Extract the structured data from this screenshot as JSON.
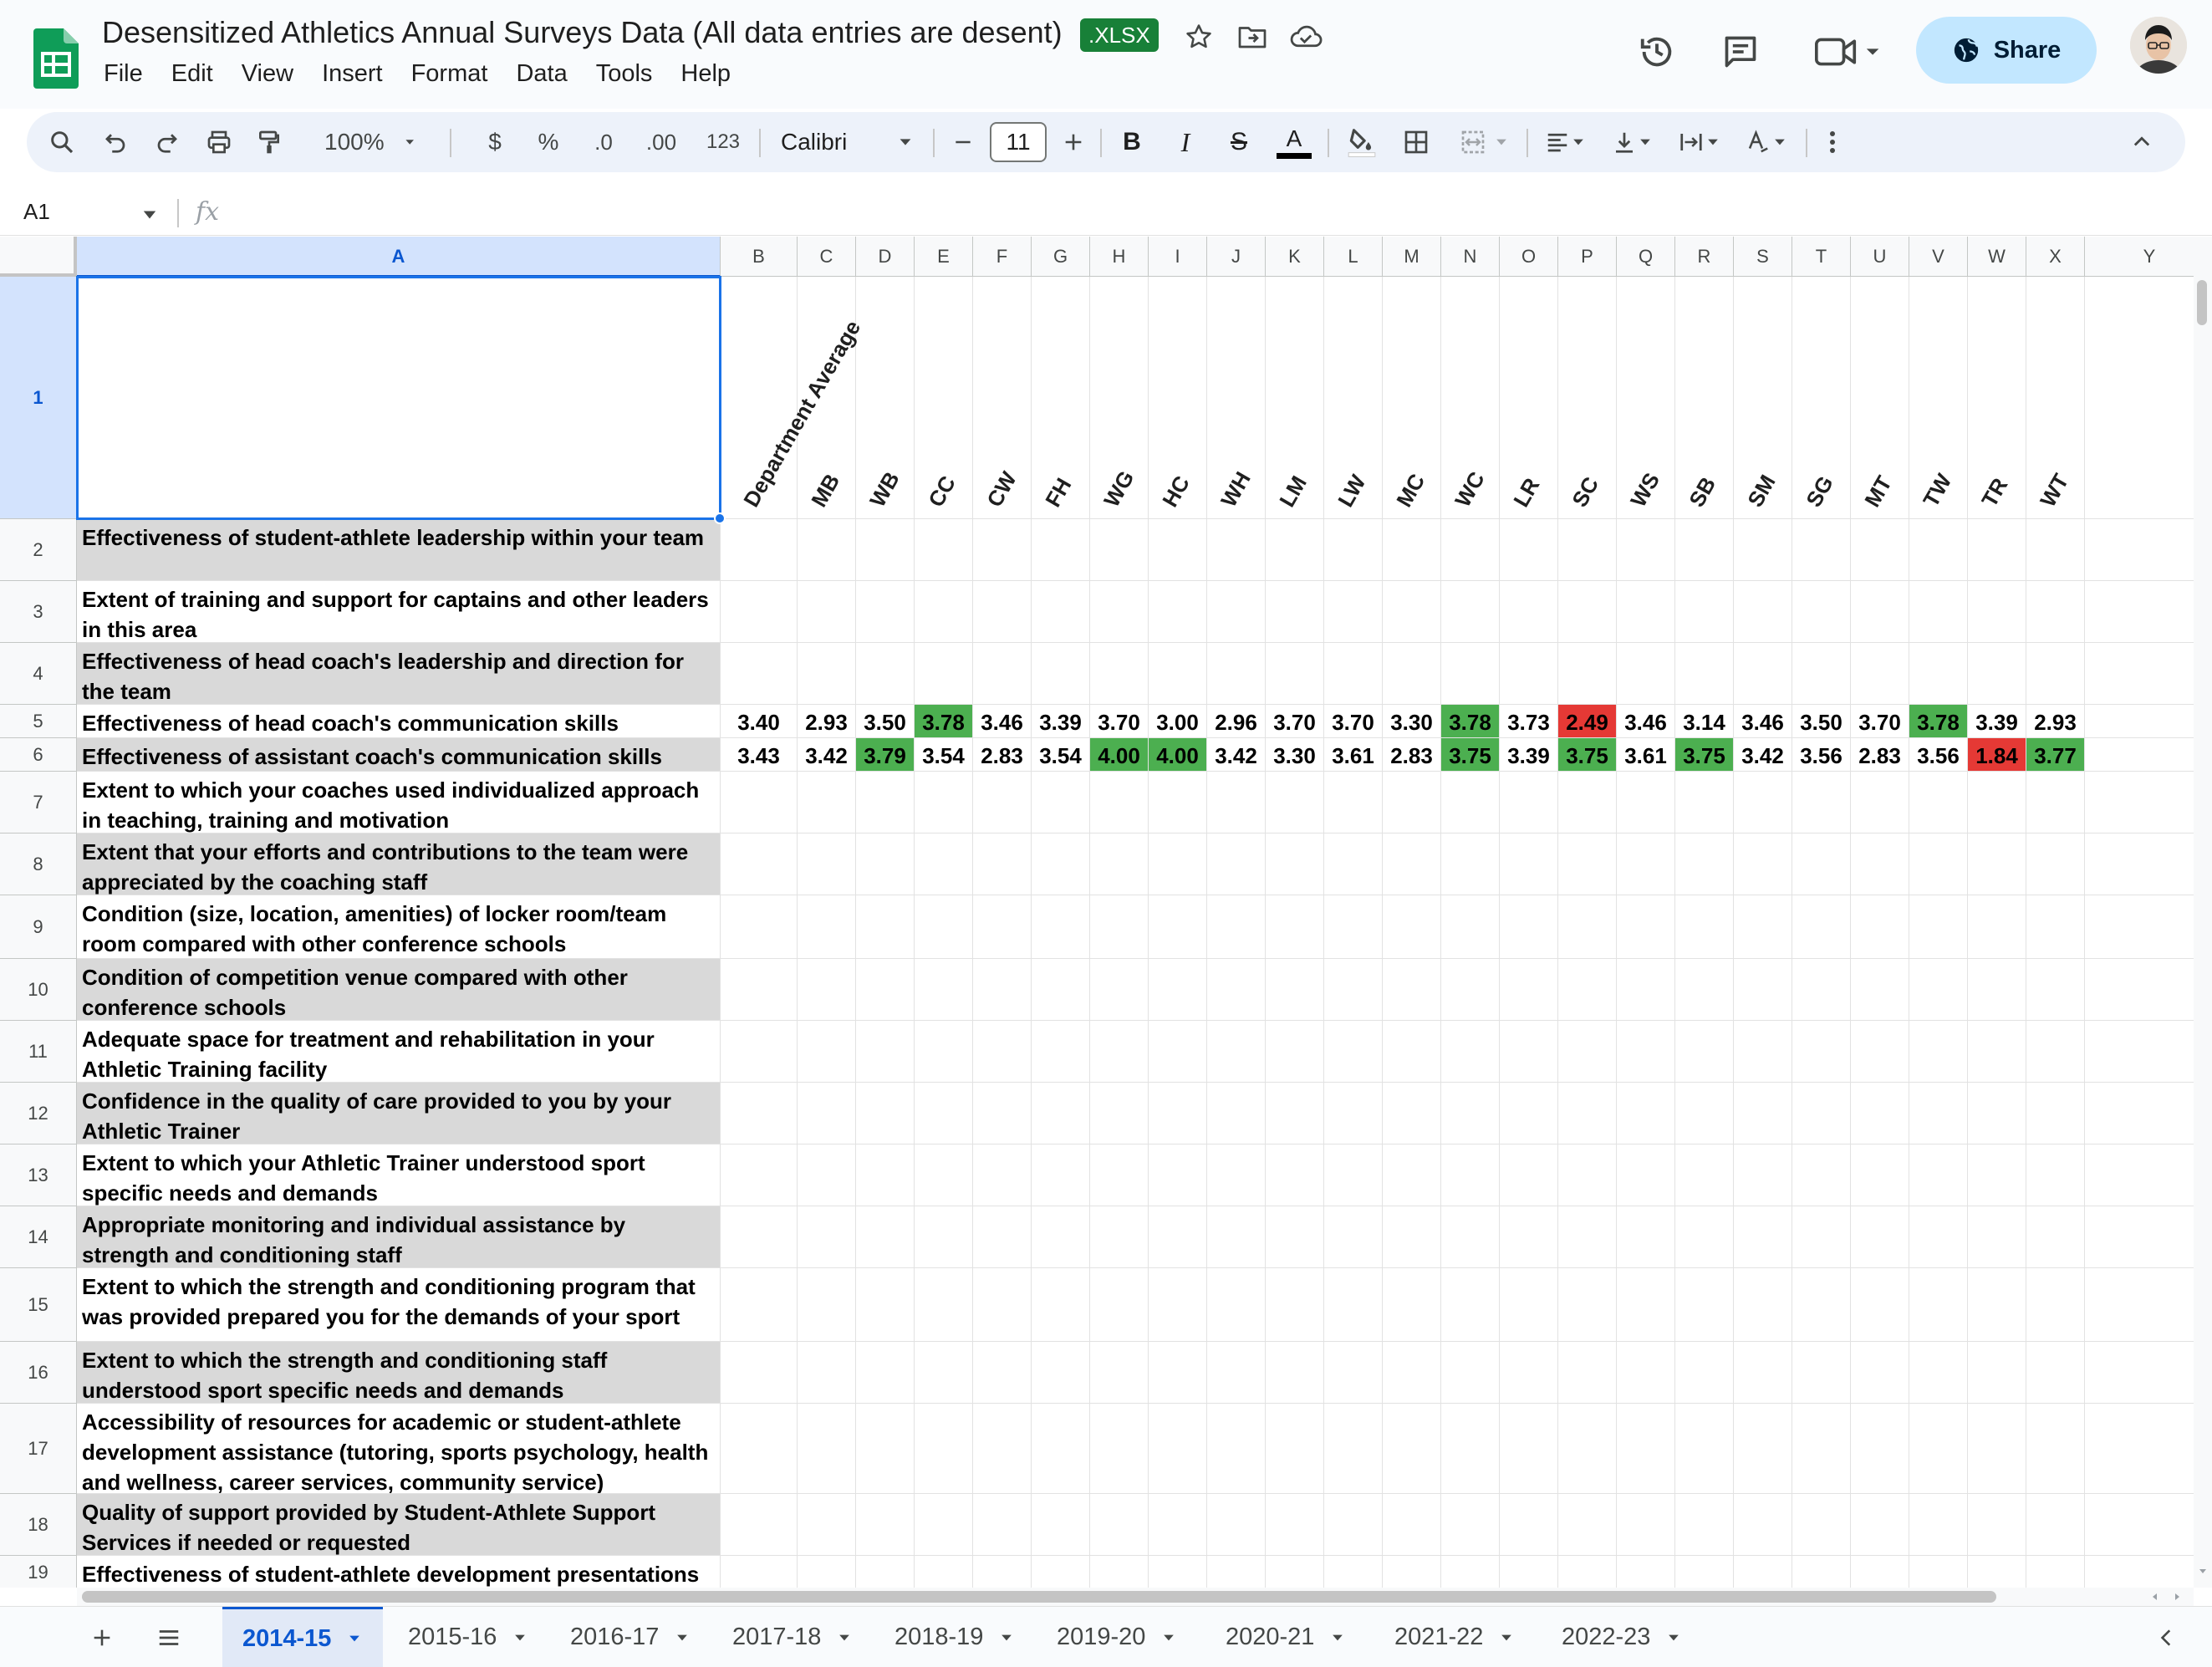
{
  "document": {
    "title": "Desensitized Athletics Annual Surveys Data (All data entries are desent)",
    "format_badge": ".XLSX"
  },
  "menu": [
    "File",
    "Edit",
    "View",
    "Insert",
    "Format",
    "Data",
    "Tools",
    "Help"
  ],
  "share": {
    "label": "Share"
  },
  "toolbar": {
    "zoom": "100%",
    "currency": "$",
    "percent": "%",
    "decrease_decimal": ".0",
    "increase_decimal": ".00",
    "number_format": "123",
    "font": "Calibri",
    "font_size": "11",
    "bold": "B",
    "italic": "I",
    "strike": "S",
    "text_color": "A"
  },
  "formula_bar": {
    "cell_ref": "A1",
    "fx": "fx",
    "value": ""
  },
  "grid": {
    "column_headers": [
      "A",
      "B",
      "C",
      "D",
      "E",
      "F",
      "G",
      "H",
      "I",
      "J",
      "K",
      "L",
      "M",
      "N",
      "O",
      "P",
      "Q",
      "R",
      "S",
      "T",
      "U",
      "V",
      "W",
      "X",
      "Y"
    ],
    "row_numbers": [
      "1",
      "2",
      "3",
      "4",
      "5",
      "6",
      "7",
      "8",
      "9",
      "10",
      "11",
      "12",
      "13",
      "14",
      "15",
      "16",
      "17",
      "18",
      "19"
    ],
    "team_headers": [
      "Department Average",
      "MB",
      "WB",
      "CC",
      "CW",
      "FH",
      "WG",
      "HC",
      "WH",
      "LM",
      "LW",
      "MC",
      "WC",
      "LR",
      "SC",
      "WS",
      "SB",
      "SM",
      "SG",
      "MT",
      "TW",
      "TR",
      "WT"
    ],
    "questions": [
      "",
      "Effectiveness of student-athlete leadership within your team",
      "Extent of training and support for captains and other leaders in this area",
      "Effectiveness of head coach's leadership and direction for the team",
      "Effectiveness of head coach's communication skills",
      "Effectiveness of assistant coach's communication skills",
      "Extent to which your coaches used individualized approach in teaching, training and motivation",
      "Extent that your efforts and contributions to the team were appreciated by the coaching staff",
      "Condition (size, location, amenities) of locker room/team room compared with other conference schools",
      "Condition of competition venue compared with other conference schools",
      "Adequate space for treatment and rehabilitation in your Athletic Training facility",
      "Confidence in the quality of care provided to you by your Athletic Trainer",
      "Extent to which your Athletic Trainer understood sport specific needs and demands",
      "Appropriate monitoring and individual assistance by strength and conditioning staff",
      "Extent to which the strength and conditioning program that was provided prepared you for the demands of your sport",
      "Extent to which the strength and conditioning staff understood sport specific needs and demands",
      "Accessibility of resources for academic or student-athlete development assistance (tutoring, sports psychology, health and wellness, career services, community service)",
      "Quality of support provided by Student-Athlete Support Services if needed or requested",
      "Effectiveness of student-athlete development presentations"
    ],
    "row5_values": [
      "3.40",
      "2.93",
      "3.50",
      "3.78",
      "3.46",
      "3.39",
      "3.70",
      "3.00",
      "2.96",
      "3.70",
      "3.70",
      "3.30",
      "3.78",
      "3.73",
      "2.49",
      "3.46",
      "3.14",
      "3.46",
      "3.50",
      "3.70",
      "3.78",
      "3.39",
      "2.93"
    ],
    "row5_colors": [
      "",
      "",
      "",
      "green",
      "",
      "",
      "",
      "",
      "",
      "",
      "",
      "",
      "green",
      "",
      "red",
      "",
      "",
      "",
      "",
      "",
      "green",
      "",
      ""
    ],
    "row6_values": [
      "3.43",
      "3.42",
      "3.79",
      "3.54",
      "2.83",
      "3.54",
      "4.00",
      "4.00",
      "3.42",
      "3.30",
      "3.61",
      "2.83",
      "3.75",
      "3.39",
      "3.75",
      "3.61",
      "3.75",
      "3.42",
      "3.56",
      "2.83",
      "3.56",
      "1.84",
      "3.77"
    ],
    "row6_colors": [
      "",
      "",
      "green",
      "",
      "",
      "",
      "green",
      "green",
      "",
      "",
      "",
      "",
      "green",
      "",
      "green",
      "",
      "green",
      "",
      "",
      "",
      "",
      "red",
      "green"
    ]
  },
  "sheets": {
    "tabs": [
      "2014-15",
      "2015-16",
      "2016-17",
      "2017-18",
      "2018-19",
      "2019-20",
      "2020-21",
      "2021-22",
      "2022-23"
    ],
    "active": "2014-15"
  },
  "colors": {
    "accent": "#0b57d0",
    "green_cell": "#4caf50",
    "red_cell": "#e53935",
    "gray_row": "#d9d9d9",
    "share_bg": "#c2e7ff",
    "xlsx_badge": "#188038"
  },
  "icons": {
    "title_bar": [
      "star-icon",
      "move-to-folder-icon",
      "cloud-saved-icon"
    ],
    "top_right": [
      "version-history-icon",
      "comments-icon",
      "meet-video-icon",
      "globe-icon"
    ],
    "toolbar": [
      "search-icon",
      "undo-icon",
      "redo-icon",
      "print-icon",
      "paint-format-icon",
      "borders-icon",
      "merge-cells-icon",
      "align-left-icon",
      "valign-bottom-icon",
      "text-wrap-icon",
      "text-rotate-icon",
      "more-vert-icon",
      "collapse-up-icon"
    ],
    "sheet_bar": [
      "add-sheet-icon",
      "all-sheets-menu-icon",
      "collapse-tabs-icon"
    ]
  }
}
